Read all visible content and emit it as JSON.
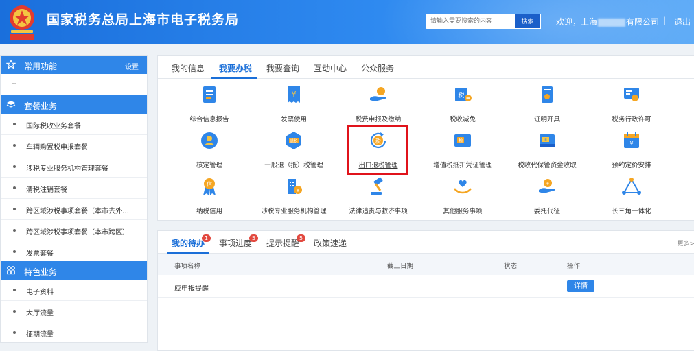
{
  "header": {
    "title": "国家税务总局上海市电子税务局",
    "search_placeholder": "请输入需要搜索的内容",
    "search_button": "搜索",
    "welcome_prefix": "欢迎，上海",
    "welcome_suffix": "有限公司",
    "separator": "|",
    "logout": "退出",
    "brand_color": "#1a6fdc"
  },
  "sidebar": {
    "common": {
      "label": "常用功能",
      "action": "设置",
      "icon": "star-icon"
    },
    "common_items": [
      "--"
    ],
    "package": {
      "label": "套餐业务",
      "icon": "layers-icon"
    },
    "package_items": [
      "国际税收业务套餐",
      "车辆购置税申报套餐",
      "涉税专业服务机构管理套餐",
      "清税注销套餐",
      "跨区域涉税事项套餐（本市去外…",
      "跨区域涉税事项套餐（本市跨区）",
      "发票套餐"
    ],
    "special": {
      "label": "特色业务",
      "icon": "grid-icon"
    },
    "special_items": [
      "电子资料",
      "大厅流量",
      "征期流量"
    ]
  },
  "services": {
    "tabs": [
      "我的信息",
      "我要办税",
      "我要查询",
      "互动中心",
      "公众服务"
    ],
    "active_tab": "我要办税",
    "items": [
      {
        "label": "综合信息报告",
        "icon": "document-report-icon"
      },
      {
        "label": "发票使用",
        "icon": "invoice-yen-icon"
      },
      {
        "label": "税费申报及缴纳",
        "icon": "hand-coin-icon"
      },
      {
        "label": "税收减免",
        "icon": "tax-reduction-icon"
      },
      {
        "label": "证明开具",
        "icon": "certificate-icon"
      },
      {
        "label": "税务行政许可",
        "icon": "license-badge-icon"
      },
      {
        "label": "核定管理",
        "icon": "user-circle-icon"
      },
      {
        "label": "一般退（抵）税管理",
        "icon": "refund-hexagon-icon"
      },
      {
        "label": "出口退税管理",
        "icon": "tax-refresh-icon"
      },
      {
        "label": "增值税抵扣凭证管理",
        "icon": "voucher-icon"
      },
      {
        "label": "税收代保管资金收取",
        "icon": "wallet-yen-icon"
      },
      {
        "label": "预约定价安排",
        "icon": "calendar-icon"
      },
      {
        "label": "纳税信用",
        "icon": "credit-medal-icon"
      },
      {
        "label": "涉税专业服务机构管理",
        "icon": "building-yen-icon"
      },
      {
        "label": "法律追责与救济事项",
        "icon": "gavel-icon"
      },
      {
        "label": "其他服务事项",
        "icon": "heart-hands-icon"
      },
      {
        "label": "委托代征",
        "icon": "hand-yen-icon"
      },
      {
        "label": "长三角一体化",
        "icon": "triangle-network-icon"
      }
    ]
  },
  "todo": {
    "tabs": [
      {
        "label": "我的待办",
        "badge": "1"
      },
      {
        "label": "事项进度",
        "badge": "5"
      },
      {
        "label": "提示提醒",
        "badge": "5"
      },
      {
        "label": "政策速递",
        "badge": ""
      }
    ],
    "more": "更多>",
    "columns": [
      "事项名称",
      "截止日期",
      "状态",
      "操作"
    ],
    "rows": [
      {
        "name": "应申报提醒",
        "deadline": "",
        "status": "",
        "action": "详情"
      }
    ]
  }
}
